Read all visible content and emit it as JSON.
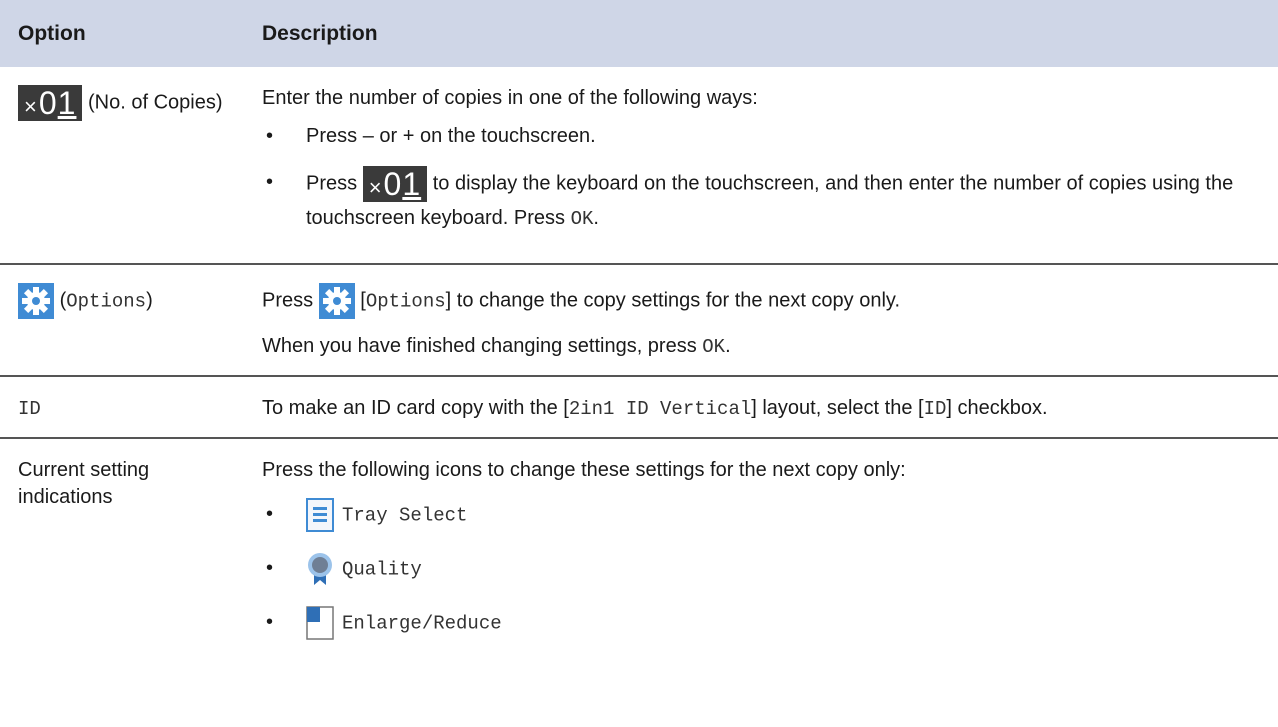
{
  "table": {
    "headers": {
      "option": "Option",
      "description": "Description"
    },
    "rows": [
      {
        "option_suffix": "(No. of Copies)",
        "intro": "Enter the number of copies in one of the following ways:",
        "bullet1_pre": "Press",
        "bullet1_minus": "–",
        "bullet1_or": "or",
        "bullet1_plus": "+",
        "bullet1_post": "on the touchscreen.",
        "bullet2_pre": "Press",
        "bullet2_post": "to display the keyboard on the touchscreen, and then enter the number of copies using the touchscreen keyboard. Press",
        "bullet2_ok": "OK",
        "bullet2_end": "."
      },
      {
        "option_label": "Options",
        "line1_pre": "Press",
        "line1_key": "Options",
        "line1_post": "to change the copy settings for the next copy only.",
        "line2_pre": "When you have finished changing settings, press",
        "line2_ok": "OK",
        "line2_end": "."
      },
      {
        "option_label": "ID",
        "desc_pre": "To make an ID card copy with the [",
        "desc_layout": "2in1 ID Vertical",
        "desc_mid": "] layout, select the [",
        "desc_key": "ID",
        "desc_post": "] checkbox."
      },
      {
        "option_label": "Current setting indications",
        "intro": "Press the following icons to change these settings for the next copy only:",
        "items": [
          "Tray Select",
          "Quality",
          "Enlarge/Reduce"
        ]
      }
    ]
  },
  "copies_icon": {
    "x": "×",
    "digits_lead": "0",
    "digits_last": "1"
  },
  "icons": {
    "copies": "copies-counter-icon",
    "options": "gear-icon",
    "tray": "tray-select-icon",
    "quality": "quality-ribbon-icon",
    "enlarge": "enlarge-reduce-icon"
  },
  "colors": {
    "header_bg": "#cfd6e7",
    "gear_bg": "#3f8bd4",
    "copies_bg": "#3a3a3a",
    "icon_blue": "#3f8bd4"
  }
}
